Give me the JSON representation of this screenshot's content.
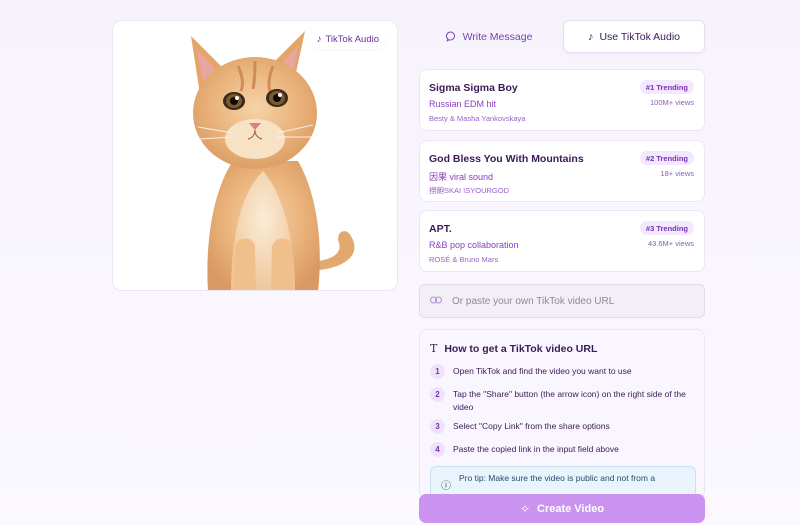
{
  "image": {
    "badge_label": "TikTok Audio",
    "note_icon": "music-note-icon"
  },
  "tabs": [
    {
      "label": "Write Message",
      "icon": "message-circle-icon",
      "active": false
    },
    {
      "label": "Use TikTok Audio",
      "icon": "music-note-icon",
      "active": true
    }
  ],
  "songs": [
    {
      "title": "Sigma Sigma Boy",
      "subtitle": "Russian EDM hit",
      "artist": "Besty & Masha Yankovskaya",
      "trend": "#1 Trending",
      "views": "100M+ views"
    },
    {
      "title": "God Bless You With Mountains",
      "subtitle": "因果 viral sound",
      "artist": "撈飽SKAI ISYOURGOD",
      "trend": "#2 Trending",
      "views": "18+ views"
    },
    {
      "title": "APT.",
      "subtitle": "R&B pop collaboration",
      "artist": "ROSÉ & Bruno Mars",
      "trend": "#3 Trending",
      "views": "43.6M+ views"
    }
  ],
  "url_input": {
    "placeholder": "Or paste your own TikTok video URL",
    "value": ""
  },
  "howto": {
    "title": "How to get a TikTok video URL",
    "steps": [
      {
        "num": "1",
        "text": "Open TikTok and find the video you want to use"
      },
      {
        "num": "2",
        "text": "Tap the \"Share\" button (the arrow icon) on the right side of the video"
      },
      {
        "num": "3",
        "text": "Select \"Copy Link\" from the share options"
      },
      {
        "num": "4",
        "text": "Paste the copied link in the input field above"
      }
    ],
    "protip": "Pro tip: Make sure the video is public and not from a"
  },
  "create_button": {
    "label": "Create Video"
  },
  "colors": {
    "accent": "#7a2fb8",
    "button": "#cb93f0",
    "background": "#f7f3fd"
  }
}
